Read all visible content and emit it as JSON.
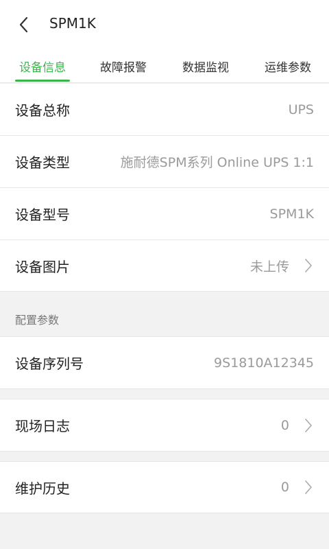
{
  "header": {
    "title": "SPM1K"
  },
  "tabs": [
    {
      "label": "设备信息",
      "active": true
    },
    {
      "label": "故障报警",
      "active": false
    },
    {
      "label": "数据监视",
      "active": false
    },
    {
      "label": "运维参数",
      "active": false
    }
  ],
  "info": {
    "name": {
      "label": "设备总称",
      "value": "UPS"
    },
    "type": {
      "label": "设备类型",
      "value": "施耐德SPM系列 Online UPS 1:1"
    },
    "model": {
      "label": "设备型号",
      "value": "SPM1K"
    },
    "image": {
      "label": "设备图片",
      "value": "未上传"
    }
  },
  "config": {
    "section_title": "配置参数",
    "serial": {
      "label": "设备序列号",
      "value": "9S1810A12345"
    }
  },
  "site_log": {
    "label": "现场日志",
    "value": "0"
  },
  "maintenance": {
    "label": "维护历史",
    "value": "0"
  },
  "colors": {
    "accent": "#3bb54a",
    "background": "#f2f2f2"
  },
  "icons": {
    "back": "chevron-left-icon",
    "row_arrow": "chevron-right-icon"
  }
}
